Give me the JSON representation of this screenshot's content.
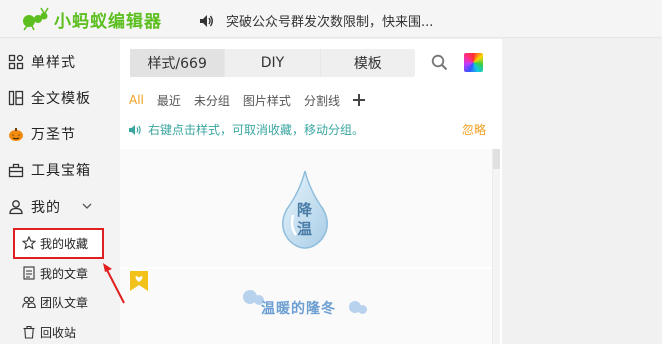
{
  "header": {
    "logo_text": "小蚂蚁编辑器",
    "notice": "突破公众号群发次数限制，快来围..."
  },
  "sidebar": {
    "items": [
      {
        "label": "单样式",
        "icon": "grid-icon"
      },
      {
        "label": "全文模板",
        "icon": "layout-icon"
      },
      {
        "label": "万圣节",
        "icon": "pumpkin-icon"
      },
      {
        "label": "工具宝箱",
        "icon": "toolbox-icon"
      },
      {
        "label": "我的",
        "icon": "user-icon"
      }
    ],
    "sub_items": [
      {
        "label": "我的收藏",
        "icon": "star-icon"
      },
      {
        "label": "我的文章",
        "icon": "document-icon"
      },
      {
        "label": "团队文章",
        "icon": "team-icon"
      },
      {
        "label": "回收站",
        "icon": "trash-icon"
      }
    ]
  },
  "panel": {
    "tabs": [
      {
        "label": "样式/669",
        "active": true
      },
      {
        "label": "DIY",
        "active": false
      },
      {
        "label": "模板",
        "active": false
      }
    ],
    "filters": [
      {
        "label": "All",
        "active": true
      },
      {
        "label": "最近",
        "active": false
      },
      {
        "label": "未分组",
        "active": false
      },
      {
        "label": "图片样式",
        "active": false
      },
      {
        "label": "分割线",
        "active": false
      }
    ],
    "tip": "右键点击样式，可取消收藏，移动分组。",
    "ignore_label": "忽略",
    "card1": {
      "line1": "降",
      "line2": "温"
    },
    "card2": {
      "text": "温暖的隆冬"
    }
  },
  "colors": {
    "brand": "#5cbf1f",
    "accent": "#f0a020",
    "tip": "#3aa6a0",
    "highlight": "#e02020"
  }
}
